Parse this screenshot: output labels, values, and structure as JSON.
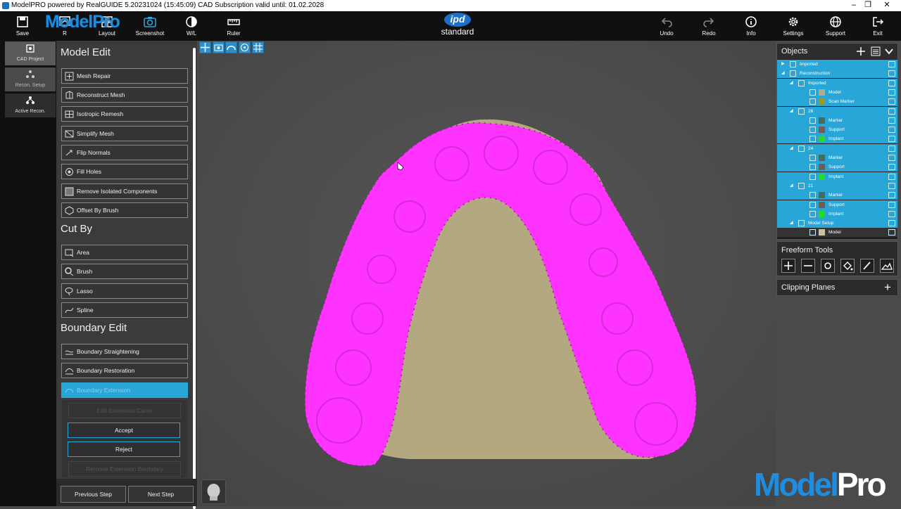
{
  "window": {
    "title": "ModelPRO powered by RealGUIDE  5.20231024 (15:45:09)  CAD Subscription valid until: 01.02.2028",
    "minimize": "–",
    "maximize": "❐",
    "close": "✕"
  },
  "toolbar": {
    "save": "Save",
    "reset": "R",
    "layout": "Layout",
    "screenshot": "Screenshot",
    "wl": "W/L",
    "ruler": "Ruler",
    "undo": "Undo",
    "redo": "Redo",
    "info": "Info",
    "settings": "Settings",
    "support": "Support",
    "exit": "Exit",
    "brand": "ModelPro",
    "ipd_logo": "ipd",
    "ipd_sub": "standard"
  },
  "left_tabs": {
    "cad_project": "CAD Project",
    "recon_setup": "Recon. Setup",
    "active_recon": "Active Recon."
  },
  "panel": {
    "model_edit_title": "Model Edit",
    "model_edit_tools": [
      "Mesh Repair",
      "Reconstruct Mesh",
      "Isotropic Remesh",
      "Simplify Mesh",
      "Flip Normals",
      "Fill Holes",
      "Remove Isolated Components",
      "Offset By Brush"
    ],
    "cut_by_title": "Cut By",
    "cut_by_tools": [
      "Area",
      "Brush",
      "Lasso",
      "Spline"
    ],
    "boundary_title": "Boundary Edit",
    "boundary_tools": [
      "Boundary Straightening",
      "Boundary Restoration",
      "Boundary Extension"
    ],
    "ext_top": "Edit Extension Curve",
    "accept": "Accept",
    "reject": "Reject",
    "ext_bottom": "Remove Extension Boundary",
    "previous": "Previous Step",
    "next": "Next Step"
  },
  "objects": {
    "title": "Objects",
    "rows": [
      {
        "label": "Imported",
        "indent": 0,
        "arrow": "▶",
        "swatch": null
      },
      {
        "label": "Reconstruction",
        "indent": 0,
        "arrow": "◢",
        "swatch": null
      },
      {
        "label": "Imported",
        "indent": 1,
        "arrow": "◢",
        "swatch": null
      },
      {
        "label": "Model",
        "indent": 2,
        "arrow": "",
        "swatch": "#b5aa86"
      },
      {
        "label": "Scan Marker",
        "indent": 2,
        "arrow": "",
        "swatch": "#9a9a2c"
      },
      {
        "label": "26",
        "indent": 1,
        "arrow": "◢",
        "swatch": null
      },
      {
        "label": "Marker",
        "indent": 2,
        "arrow": "",
        "swatch": "#4a6a5a"
      },
      {
        "label": "Support",
        "indent": 2,
        "arrow": "",
        "swatch": "#7a5a4a"
      },
      {
        "label": "Implant",
        "indent": 2,
        "arrow": "",
        "swatch": "#22dd22"
      },
      {
        "label": "24",
        "indent": 1,
        "arrow": "◢",
        "swatch": null
      },
      {
        "label": "Marker",
        "indent": 2,
        "arrow": "",
        "swatch": "#4a6a5a"
      },
      {
        "label": "Support",
        "indent": 2,
        "arrow": "",
        "swatch": "#7a5a4a"
      },
      {
        "label": "Implant",
        "indent": 2,
        "arrow": "",
        "swatch": "#22dd22"
      },
      {
        "label": "21",
        "indent": 1,
        "arrow": "◢",
        "swatch": null
      },
      {
        "label": "Marker",
        "indent": 2,
        "arrow": "",
        "swatch": "#4a6a5a"
      },
      {
        "label": "Support",
        "indent": 2,
        "arrow": "",
        "swatch": "#7a5a4a"
      },
      {
        "label": "Implant",
        "indent": 2,
        "arrow": "",
        "swatch": "#22dd22"
      },
      {
        "label": "Model Setup",
        "indent": 1,
        "arrow": "◢",
        "swatch": null
      },
      {
        "label": "Model",
        "indent": 2,
        "arrow": "",
        "swatch": "#c9c0a0"
      }
    ]
  },
  "freeform": {
    "title": "Freeform Tools"
  },
  "clipping": {
    "title": "Clipping Planes",
    "add": "+"
  },
  "watermark": {
    "part1": "Model",
    "part2": "Pro"
  },
  "colors": {
    "accent": "#29a6d8",
    "model_highlight": "#ff33ff",
    "model_base": "#b8ad82",
    "brand_blue": "#1e8ddf"
  }
}
